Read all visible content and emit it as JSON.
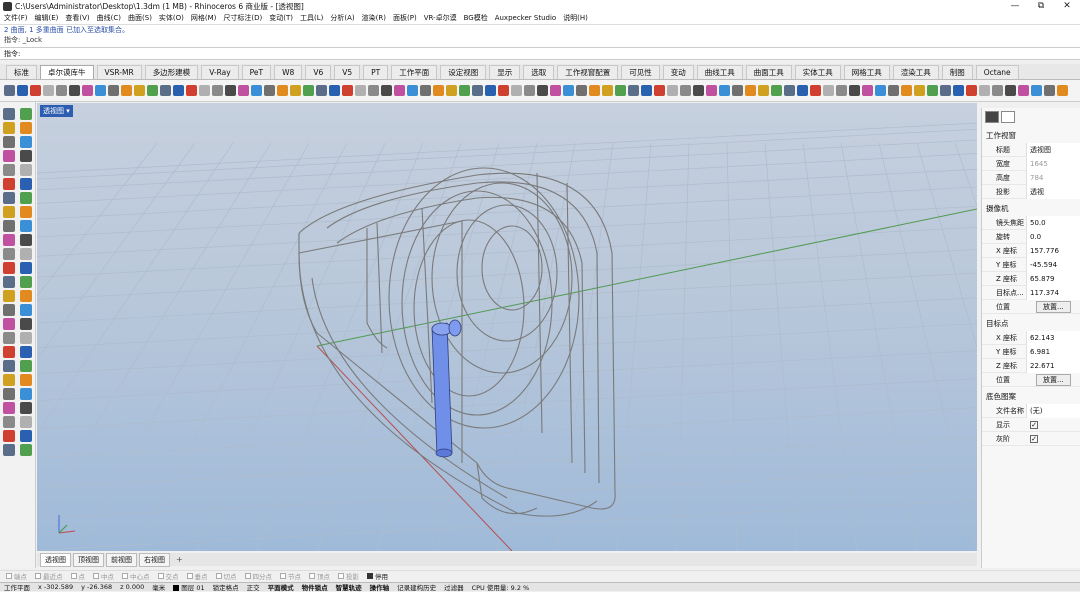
{
  "window": {
    "title": "C:\\Users\\Administrator\\Desktop\\1.3dm (1 MB) - Rhinoceros 6 商业版 - [透视图]",
    "min": "—",
    "max": "⧉",
    "close": "✕"
  },
  "menu": [
    "文件(F)",
    "编辑(E)",
    "查看(V)",
    "曲线(C)",
    "曲面(S)",
    "实体(O)",
    "网格(M)",
    "尺寸标注(D)",
    "变动(T)",
    "工具(L)",
    "分析(A)",
    "渲染(R)",
    "面板(P)",
    "VR-卓尔谟",
    "BG模检",
    "Auxpecker Studio",
    "说明(H)"
  ],
  "history": {
    "line1": "2 曲面, 1 多重曲面 已加入至选取集合。",
    "line2": "指令: _Lock",
    "prompt": "指令:"
  },
  "tabs": [
    "标准",
    "卓尔谟库牛",
    "VSR-MR",
    "多边形建模",
    "V-Ray",
    "PeT",
    "W8",
    "V6",
    "V5",
    "PT",
    "工作平面",
    "设定视图",
    "显示",
    "选取",
    "工作视窗配置",
    "可见性",
    "变动",
    "曲线工具",
    "曲面工具",
    "实体工具",
    "网格工具",
    "渲染工具",
    "制图",
    "Octane"
  ],
  "active_tab_index": 1,
  "viewport": {
    "label": "透视图 ▾"
  },
  "viewport_tabs": [
    "透视图",
    "顶视图",
    "前视图",
    "右视图"
  ],
  "osnap": [
    {
      "label": "端点",
      "on": false
    },
    {
      "label": "最近点",
      "on": false
    },
    {
      "label": "点",
      "on": false
    },
    {
      "label": "中点",
      "on": false
    },
    {
      "label": "中心点",
      "on": false
    },
    {
      "label": "交点",
      "on": false
    },
    {
      "label": "垂点",
      "on": false
    },
    {
      "label": "切点",
      "on": false
    },
    {
      "label": "四分点",
      "on": false
    },
    {
      "label": "节点",
      "on": false
    },
    {
      "label": "顶点",
      "on": false
    },
    {
      "label": "投影",
      "on": false
    },
    {
      "label": "停用",
      "on": true
    }
  ],
  "status": {
    "plane": "工作平面",
    "x": "x -302.589",
    "y": "y -26.368",
    "z": "z 0.000",
    "unit": "毫米",
    "layer": "图层 01",
    "items": [
      "锁定格点",
      "正交",
      "平面模式",
      "物件锁点",
      "智慧轨迹",
      "操作轴",
      "记录建构历史",
      "过滤器",
      "CPU 使用量: 9.2 %"
    ]
  },
  "panel": {
    "section_viewport": "工作视窗",
    "rows_viewport": [
      {
        "k": "标题",
        "v": "透视图",
        "grey": false
      },
      {
        "k": "宽度",
        "v": "1645",
        "grey": true
      },
      {
        "k": "高度",
        "v": "784",
        "grey": true
      },
      {
        "k": "投影",
        "v": "透视",
        "grey": false
      }
    ],
    "section_camera": "摄像机",
    "rows_camera": [
      {
        "k": "镜头焦距",
        "v": "50.0"
      },
      {
        "k": "旋转",
        "v": "0.0"
      },
      {
        "k": "X 座标",
        "v": "157.776"
      },
      {
        "k": "Y 座标",
        "v": "-45.594"
      },
      {
        "k": "Z 座标",
        "v": "65.879"
      },
      {
        "k": "目标点...",
        "v": "117.374"
      }
    ],
    "position_label": "位置",
    "place_button": "放置...",
    "section_target": "目标点",
    "rows_target": [
      {
        "k": "X 座标",
        "v": "62.143"
      },
      {
        "k": "Y 座标",
        "v": "6.981"
      },
      {
        "k": "Z 座标",
        "v": "22.671"
      }
    ],
    "section_wallpaper": "底色图案",
    "rows_wallpaper": [
      {
        "k": "文件名称",
        "v": "(无)"
      }
    ],
    "show_label": "显示",
    "gray_label": "灰阶",
    "check": "✓"
  },
  "colors": {
    "accent": "#2d5db0",
    "part": "#6f8fe8",
    "wire": "#7a7a7a"
  }
}
